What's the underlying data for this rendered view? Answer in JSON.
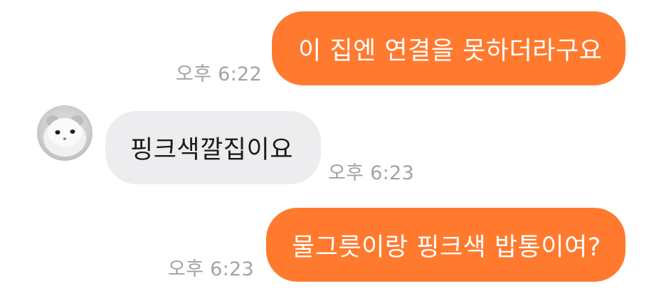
{
  "colors": {
    "accent": "#ff7a2f",
    "incoming_bubble": "#ededf0",
    "timestamp": "#a3a3a3"
  },
  "messages": [
    {
      "direction": "outgoing",
      "text": "이 집엔 연결을 못하더라구요",
      "time": "오후 6:22"
    },
    {
      "direction": "incoming",
      "text": "핑크색깔집이요",
      "time": "오후 6:23"
    },
    {
      "direction": "outgoing",
      "text": "물그릇이랑 핑크색 밥통이여?",
      "time": "오후 6:23"
    }
  ],
  "contact": {
    "avatar_icon": "hamster-avatar-icon"
  }
}
